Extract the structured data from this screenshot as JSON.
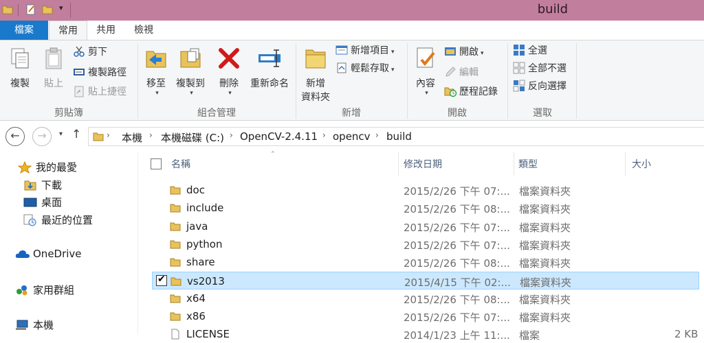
{
  "window": {
    "title": "build"
  },
  "tabs": [
    "檔案",
    "常用",
    "共用",
    "檢視"
  ],
  "ribbon": {
    "clipboard": {
      "copy": "複製",
      "paste": "貼上",
      "cut": "剪下",
      "copy_path": "複製路徑",
      "paste_shortcut": "貼上捷徑",
      "group": "剪貼簿"
    },
    "organize": {
      "move_to": "移至",
      "copy_to": "複製到",
      "delete": "刪除",
      "rename": "重新命名",
      "group": "組合管理"
    },
    "new": {
      "new_folder_l1": "新增",
      "new_folder_l2": "資料夾",
      "new_item": "新增項目",
      "easy_access": "輕鬆存取",
      "group": "新增"
    },
    "open": {
      "properties": "內容",
      "open": "開啟",
      "edit": "編輯",
      "history": "歷程記錄",
      "group": "開啟"
    },
    "select": {
      "select_all": "全選",
      "select_none": "全部不選",
      "invert": "反向選擇",
      "group": "選取"
    }
  },
  "address": {
    "crumbs": [
      "本機",
      "本機磁碟 (C:)",
      "OpenCV-2.4.11",
      "opencv",
      "build"
    ]
  },
  "nav_pane": {
    "favorites": "我的最愛",
    "downloads": "下載",
    "desktop": "桌面",
    "recent": "最近的位置",
    "onedrive": "OneDrive",
    "homegroup": "家用群組",
    "this_pc": "本機"
  },
  "columns": {
    "name": "名稱",
    "date": "修改日期",
    "type": "類型",
    "size": "大小"
  },
  "files": [
    {
      "name": "doc",
      "date": "2015/2/26 下午 07:...",
      "type": "檔案資料夾",
      "size": "",
      "selected": false
    },
    {
      "name": "include",
      "date": "2015/2/26 下午 08:...",
      "type": "檔案資料夾",
      "size": "",
      "selected": false
    },
    {
      "name": "java",
      "date": "2015/2/26 下午 07:...",
      "type": "檔案資料夾",
      "size": "",
      "selected": false
    },
    {
      "name": "python",
      "date": "2015/2/26 下午 07:...",
      "type": "檔案資料夾",
      "size": "",
      "selected": false
    },
    {
      "name": "share",
      "date": "2015/2/26 下午 08:...",
      "type": "檔案資料夾",
      "size": "",
      "selected": false
    },
    {
      "name": "vs2013",
      "date": "2015/4/15 下午 02:...",
      "type": "檔案資料夾",
      "size": "",
      "selected": true
    },
    {
      "name": "x64",
      "date": "2015/2/26 下午 08:...",
      "type": "檔案資料夾",
      "size": "",
      "selected": false
    },
    {
      "name": "x86",
      "date": "2015/2/26 下午 07:...",
      "type": "檔案資料夾",
      "size": "",
      "selected": false
    },
    {
      "name": "LICENSE",
      "date": "2014/1/23 上午 11:...",
      "type": "檔案",
      "size": "2 KB",
      "selected": false
    }
  ],
  "colors": {
    "title_bar": "#c27e9d",
    "file_tab": "#1979ca",
    "selection": "#cce8ff"
  }
}
